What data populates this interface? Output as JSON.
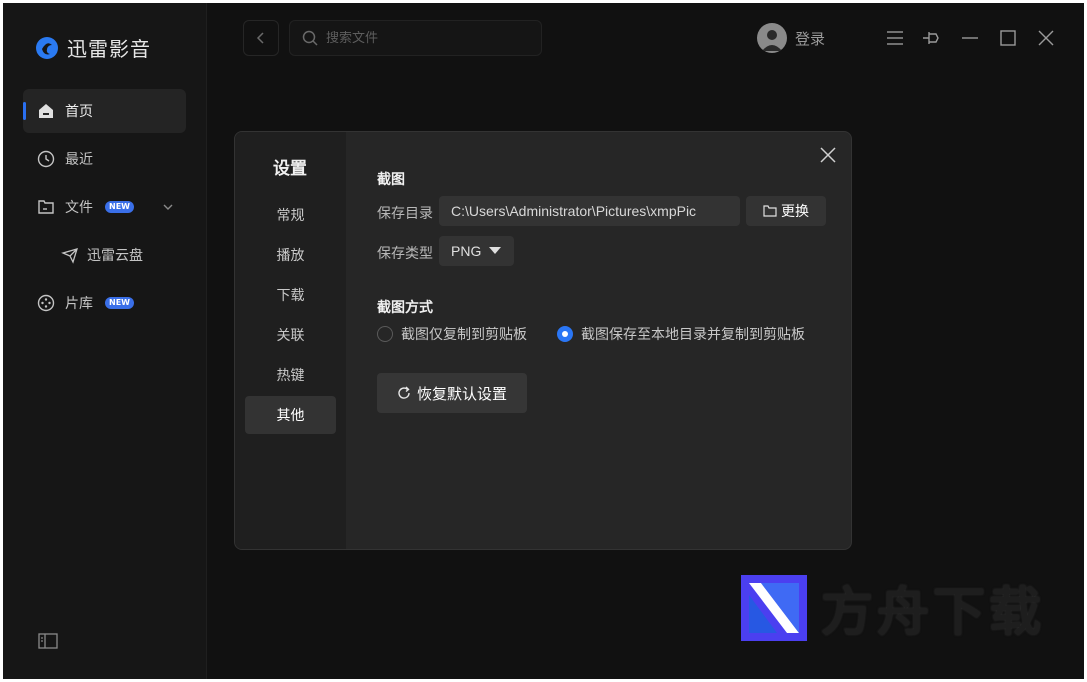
{
  "app": {
    "name": "迅雷影音"
  },
  "sidebar": {
    "items": [
      {
        "label": "首页",
        "icon": "home-icon",
        "active": true
      },
      {
        "label": "最近",
        "icon": "clock-icon"
      },
      {
        "label": "文件",
        "icon": "folder-icon",
        "badge": "NEW"
      },
      {
        "label": "片库",
        "icon": "film-reel-icon",
        "badge": "NEW"
      }
    ],
    "sub_item": {
      "label": "迅雷云盘",
      "icon": "cloud-plane-icon"
    }
  },
  "header": {
    "search_placeholder": "搜索文件",
    "login_label": "登录"
  },
  "settings": {
    "title": "设置",
    "tabs": [
      {
        "label": "常规"
      },
      {
        "label": "播放"
      },
      {
        "label": "下载"
      },
      {
        "label": "关联"
      },
      {
        "label": "热键"
      },
      {
        "label": "其他",
        "active": true
      }
    ],
    "screenshot": {
      "section_title": "截图",
      "save_dir_label": "保存目录",
      "save_dir_value": "C:\\Users\\Administrator\\Pictures\\xmpPic",
      "change_button": "更换",
      "save_type_label": "保存类型",
      "save_type_value": "PNG"
    },
    "mode": {
      "section_title": "截图方式",
      "options": [
        {
          "label": "截图仅复制到剪贴板",
          "selected": false
        },
        {
          "label": "截图保存至本地目录并复制到剪贴板",
          "selected": true
        }
      ]
    },
    "reset_button": "恢复默认设置"
  },
  "watermark": {
    "text": "方舟下载"
  },
  "colors": {
    "accent": "#2a76f5",
    "background": "#111111",
    "dialog": "#262626"
  }
}
